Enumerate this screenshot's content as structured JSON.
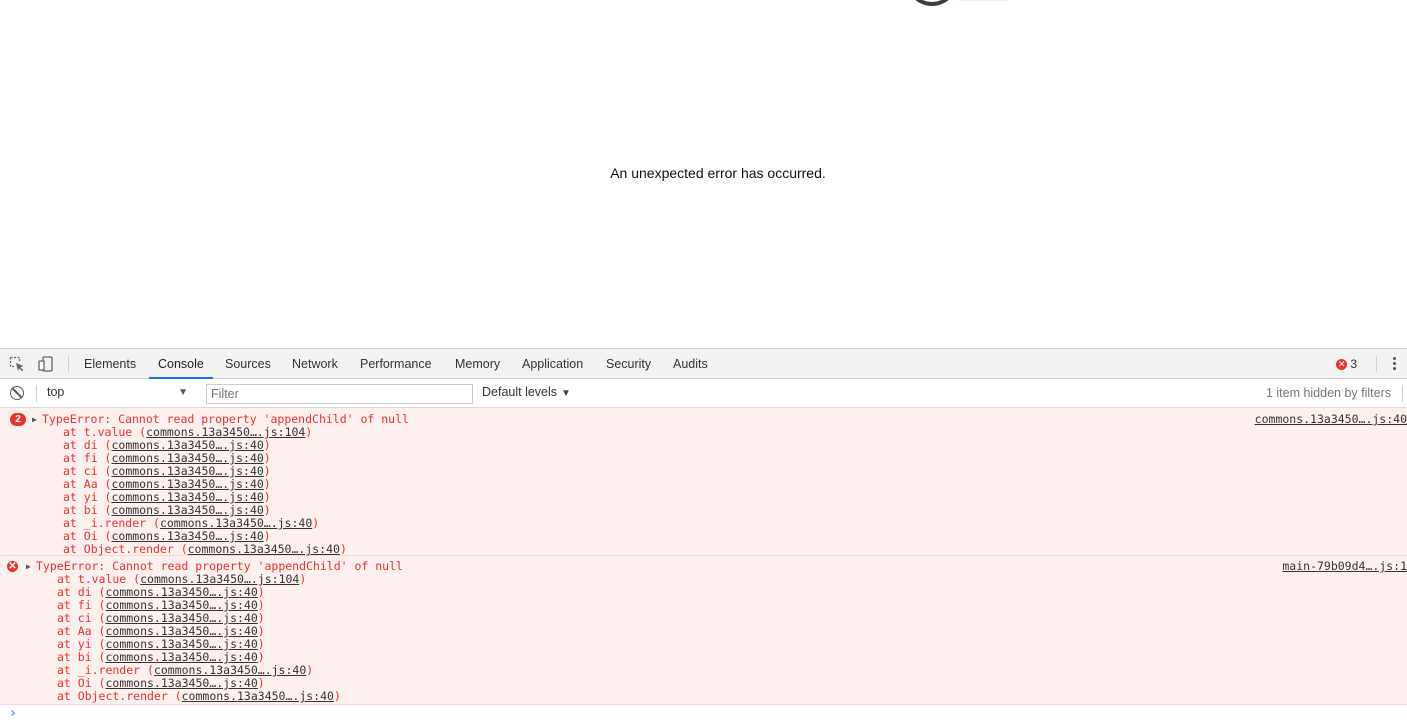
{
  "page": {
    "error_message": "An unexpected error has occurred."
  },
  "devtools": {
    "tabs": [
      {
        "label": "Elements"
      },
      {
        "label": "Console",
        "active": true
      },
      {
        "label": "Sources"
      },
      {
        "label": "Network"
      },
      {
        "label": "Performance"
      },
      {
        "label": "Memory"
      },
      {
        "label": "Application"
      },
      {
        "label": "Security"
      },
      {
        "label": "Audits"
      }
    ],
    "error_count": "3",
    "accent_color": "#1a73e8",
    "error_color": "#e8332c",
    "icons": {
      "inspect": "inspect-element-icon",
      "device": "device-toolbar-icon",
      "clear": "clear-console-icon",
      "menu": "kebab-menu-icon"
    }
  },
  "console": {
    "context": "top",
    "filter_placeholder": "Filter",
    "levels_label": "Default levels",
    "hidden_info": "1 item hidden by filters",
    "messages": [
      {
        "badge": "2",
        "title": "TypeError: Cannot read property 'appendChild' of null",
        "source": "commons.13a3450….js:40",
        "frames": [
          {
            "fn": "at t.value (",
            "loc": "commons.13a3450….js:104",
            "end": ")"
          },
          {
            "fn": "at di (",
            "loc": "commons.13a3450….js:40",
            "end": ")"
          },
          {
            "fn": "at fi (",
            "loc": "commons.13a3450….js:40",
            "end": ")"
          },
          {
            "fn": "at ci (",
            "loc": "commons.13a3450….js:40",
            "end": ")"
          },
          {
            "fn": "at Aa (",
            "loc": "commons.13a3450….js:40",
            "end": ")"
          },
          {
            "fn": "at yi (",
            "loc": "commons.13a3450….js:40",
            "end": ")"
          },
          {
            "fn": "at bi (",
            "loc": "commons.13a3450….js:40",
            "end": ")"
          },
          {
            "fn": "at _i.render (",
            "loc": "commons.13a3450….js:40",
            "end": ")"
          },
          {
            "fn": "at Oi (",
            "loc": "commons.13a3450….js:40",
            "end": ")"
          },
          {
            "fn": "at Object.render (",
            "loc": "commons.13a3450….js:40",
            "end": ")"
          }
        ]
      },
      {
        "title": "TypeError: Cannot read property 'appendChild' of null",
        "source": "main-79b09d4….js:1",
        "frames": [
          {
            "fn": "at t.value (",
            "loc": "commons.13a3450….js:104",
            "end": ")"
          },
          {
            "fn": "at di (",
            "loc": "commons.13a3450….js:40",
            "end": ")"
          },
          {
            "fn": "at fi (",
            "loc": "commons.13a3450….js:40",
            "end": ")"
          },
          {
            "fn": "at ci (",
            "loc": "commons.13a3450….js:40",
            "end": ")"
          },
          {
            "fn": "at Aa (",
            "loc": "commons.13a3450….js:40",
            "end": ")"
          },
          {
            "fn": "at yi (",
            "loc": "commons.13a3450….js:40",
            "end": ")"
          },
          {
            "fn": "at bi (",
            "loc": "commons.13a3450….js:40",
            "end": ")"
          },
          {
            "fn": "at _i.render (",
            "loc": "commons.13a3450….js:40",
            "end": ")"
          },
          {
            "fn": "at Oi (",
            "loc": "commons.13a3450….js:40",
            "end": ")"
          },
          {
            "fn": "at Object.render (",
            "loc": "commons.13a3450….js:40",
            "end": ")"
          }
        ]
      }
    ]
  }
}
